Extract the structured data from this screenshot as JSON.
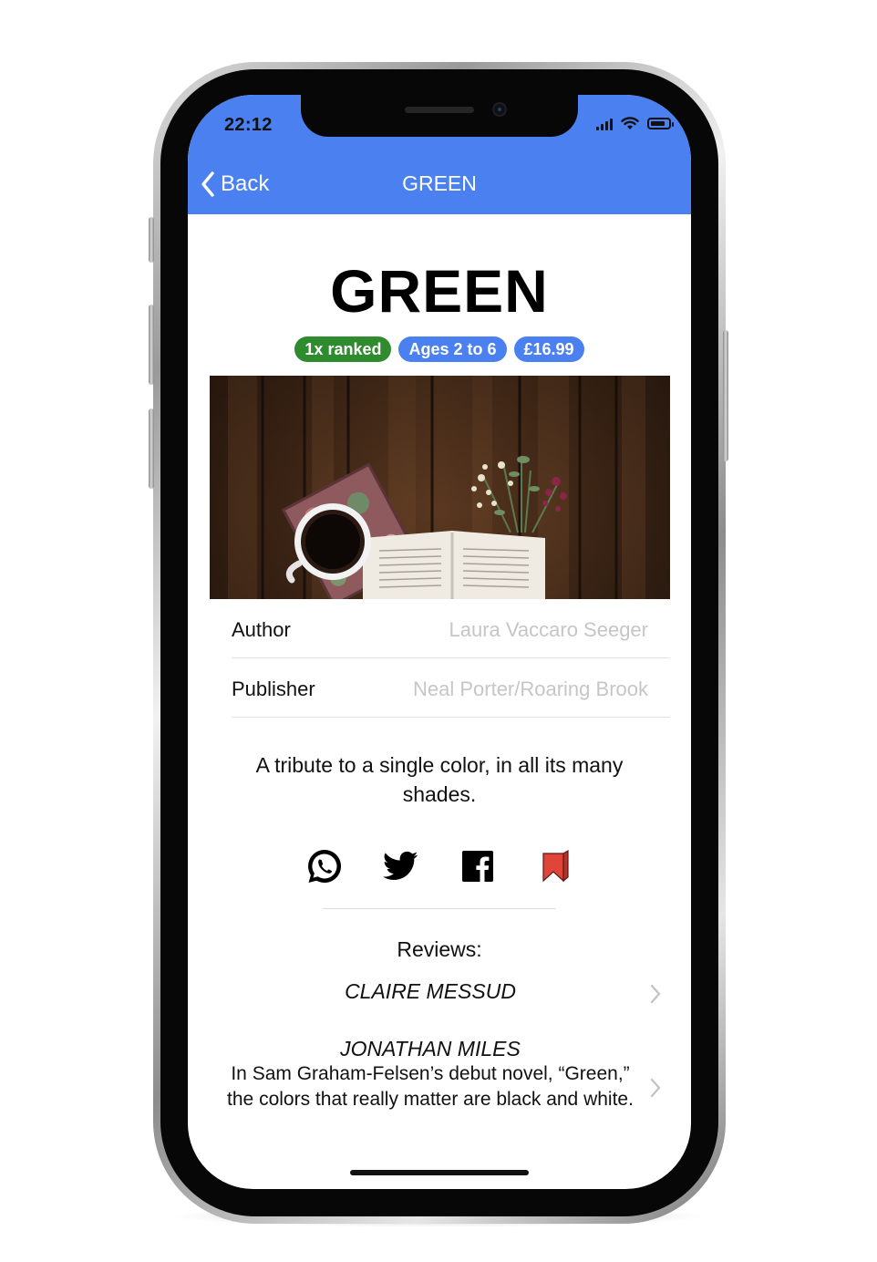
{
  "status_bar": {
    "time": "22:12"
  },
  "nav": {
    "back_label": "Back",
    "title": "GREEN"
  },
  "book": {
    "title": "GREEN",
    "badges": [
      {
        "label": "1x ranked",
        "color": "#2e8b2e"
      },
      {
        "label": "Ages 2 to 6",
        "color": "#4a80f0"
      },
      {
        "label": "£16.99",
        "color": "#4a80f0"
      }
    ],
    "cover_image": "coffee-book-flowers-on-wood",
    "details": [
      {
        "label": "Author",
        "value": "Laura Vaccaro Seeger"
      },
      {
        "label": "Publisher",
        "value": "Neal Porter/Roaring Brook"
      }
    ],
    "summary": "A tribute to a single color, in all its many shades."
  },
  "share": [
    {
      "icon": "whatsapp-icon"
    },
    {
      "icon": "twitter-icon"
    },
    {
      "icon": "facebook-icon"
    },
    {
      "icon": "bookmark-icon",
      "color": "#e0453a"
    }
  ],
  "reviews": {
    "heading": "Reviews:",
    "items": [
      {
        "reviewer": "CLAIRE MESSUD",
        "excerpt": ""
      },
      {
        "reviewer": "JONATHAN MILES",
        "excerpt": "In Sam Graham-Felsen’s debut novel, “Green,” the colors that really matter are black and white."
      }
    ]
  },
  "colors": {
    "header": "#4a80f0",
    "detail_value": "#c6c6c6",
    "text": "#111111"
  }
}
